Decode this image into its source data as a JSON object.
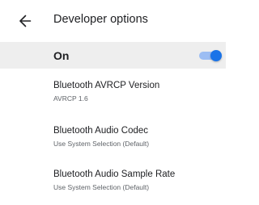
{
  "toolbar": {
    "back_icon": "arrow-back-icon",
    "title": "Developer options"
  },
  "master_switch": {
    "label": "On",
    "checked": true,
    "accent_color": "#1a73e8"
  },
  "preferences": [
    {
      "title": "Bluetooth AVRCP Version",
      "summary": "AVRCP 1.6"
    },
    {
      "title": "Bluetooth Audio Codec",
      "summary": "Use System Selection (Default)"
    },
    {
      "title": "Bluetooth Audio Sample Rate",
      "summary": "Use System Selection (Default)"
    }
  ]
}
